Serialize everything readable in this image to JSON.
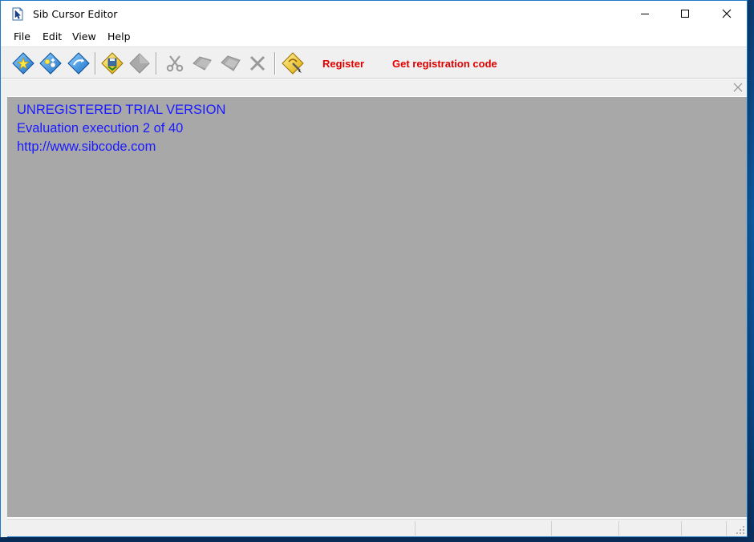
{
  "window": {
    "title": "Sib Cursor Editor",
    "controls": {
      "minimize": "minimize",
      "maximize": "maximize",
      "close": "close"
    }
  },
  "menu": {
    "items": [
      "File",
      "Edit",
      "View",
      "Help"
    ]
  },
  "toolbar": {
    "buttons": [
      {
        "name": "new-cursor",
        "icon": "diamond-star-icon",
        "enabled": true
      },
      {
        "name": "new-animated",
        "icon": "diamond-sparkle-icon",
        "enabled": true
      },
      {
        "name": "open",
        "icon": "diamond-arrow-icon",
        "enabled": true
      },
      {
        "name": "save",
        "icon": "diamond-save-icon",
        "enabled": true
      },
      {
        "name": "save-disabled",
        "icon": "diamond-gray-icon",
        "enabled": false
      },
      {
        "name": "cut",
        "icon": "scissors-icon",
        "enabled": false
      },
      {
        "name": "copy",
        "icon": "copy-icon",
        "enabled": false
      },
      {
        "name": "paste",
        "icon": "paste-icon",
        "enabled": false
      },
      {
        "name": "delete",
        "icon": "x-icon",
        "enabled": false
      },
      {
        "name": "properties",
        "icon": "diamond-pencil-icon",
        "enabled": true
      }
    ],
    "register_label": "Register",
    "get_code_label": "Get registration code"
  },
  "main": {
    "line1": "UNREGISTERED TRIAL VERSION",
    "line2": "Evaluation execution 2 of 40",
    "line3": "http://www.sibcode.com",
    "text_color": "#1a1aff",
    "background": "#a8a8a8"
  },
  "colors": {
    "link_red": "#e00000",
    "chrome": "#f0f0f0",
    "desktop_blue": "#0e5fa8"
  }
}
